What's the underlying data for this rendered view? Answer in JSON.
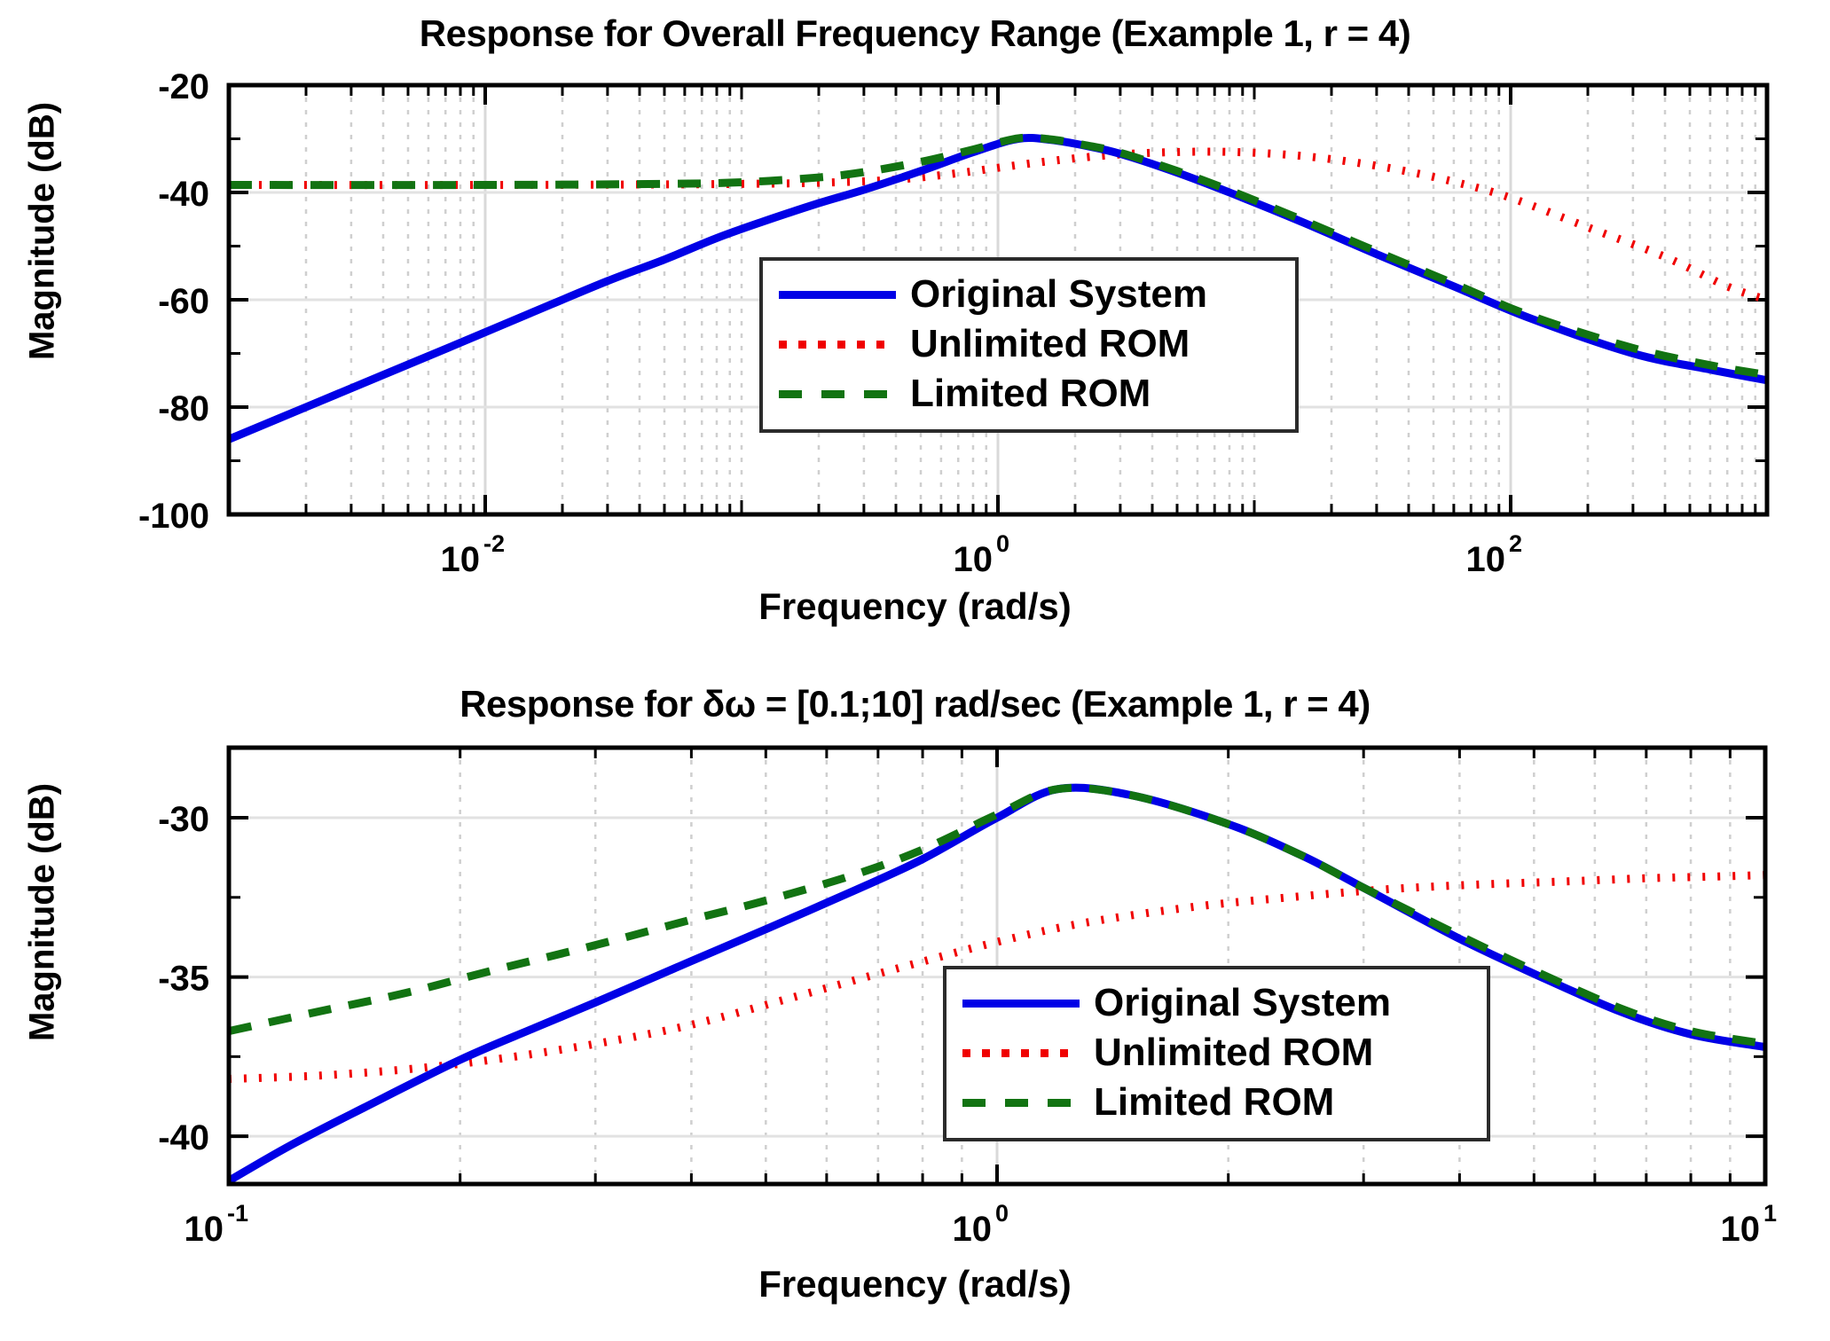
{
  "figure": {
    "background_color": "#ffffff",
    "colors": {
      "original_system": "#0000e6",
      "unlimited_rom": "#f00000",
      "limited_rom": "#127312",
      "axis": "#000000",
      "grid": "#d9d9d9"
    }
  },
  "panels": {
    "top": {
      "title": "Response for Overall Frequency Range (Example 1, r = 4)",
      "ylabel": "Magnitude (dB)",
      "xlabel": "Frequency  (rad/s)",
      "ytick_labels": [
        "-20",
        "-40",
        "-60",
        "-80",
        "-100"
      ],
      "xtick_labels": [
        "10",
        "10",
        "10"
      ],
      "xtick_exponents": [
        "-2",
        "0",
        "2"
      ],
      "legend": {
        "items": [
          {
            "label": "Original System",
            "style": "solid",
            "color": "#0000e6"
          },
          {
            "label": "Unlimited ROM",
            "style": "dotted",
            "color": "#f00000"
          },
          {
            "label": "Limited ROM",
            "style": "dashed",
            "color": "#127312"
          }
        ]
      }
    },
    "bottom": {
      "title": "Response for δω = [0.1;10] rad/sec (Example 1, r = 4)",
      "ylabel": "Magnitude (dB)",
      "xlabel": "Frequency  (rad/s)",
      "ytick_labels": [
        "-30",
        "-35",
        "-40"
      ],
      "xtick_labels": [
        "10",
        "10",
        "10"
      ],
      "xtick_exponents": [
        "-1",
        "0",
        "1"
      ],
      "legend": {
        "items": [
          {
            "label": "Original System",
            "style": "solid",
            "color": "#0000e6"
          },
          {
            "label": "Unlimited ROM",
            "style": "dotted",
            "color": "#f00000"
          },
          {
            "label": "Limited ROM",
            "style": "dashed",
            "color": "#127312"
          }
        ]
      }
    }
  },
  "chart_data": [
    {
      "type": "line",
      "id": "overall-frequency-range",
      "title": "Response for Overall Frequency Range (Example 1, r = 4)",
      "xlabel": "Frequency  (rad/s)",
      "ylabel": "Magnitude (dB)",
      "xscale": "log",
      "xlim": [
        0.001,
        1000
      ],
      "ylim": [
        -100,
        -20
      ],
      "yticks": [
        -20,
        -40,
        -60,
        -80,
        -100
      ],
      "xticks": [
        0.01,
        1,
        100
      ],
      "grid": true,
      "legend_position": "center",
      "series": [
        {
          "name": "Original System",
          "color": "#0000e6",
          "style": "solid",
          "x": [
            0.001,
            0.002,
            0.004,
            0.008,
            0.015,
            0.03,
            0.05,
            0.08,
            0.12,
            0.2,
            0.3,
            0.5,
            0.8,
            1.2,
            1.6,
            2.2,
            3.0,
            5.0,
            8.0,
            15.0,
            30.0,
            60.0,
            120.0,
            300.0,
            600.0,
            1000.0
          ],
          "y": [
            -86.0,
            -80.0,
            -74.0,
            -68.0,
            -62.5,
            -56.5,
            -52.5,
            -48.5,
            -45.5,
            -42.0,
            -39.5,
            -36.0,
            -32.5,
            -30.0,
            -30.2,
            -31.3,
            -32.8,
            -36.3,
            -40.0,
            -45.3,
            -51.5,
            -57.5,
            -63.5,
            -70.0,
            -73.0,
            -75.0
          ]
        },
        {
          "name": "Unlimited ROM",
          "color": "#f00000",
          "style": "dotted",
          "x": [
            0.001,
            0.01,
            0.05,
            0.1,
            0.2,
            0.4,
            0.7,
            1.0,
            1.5,
            2.5,
            4.0,
            7.0,
            12.0,
            20.0,
            35.0,
            60.0,
            100.0,
            200.0,
            400.0,
            700.0,
            1000.0
          ],
          "y": [
            -38.6,
            -38.6,
            -38.5,
            -38.4,
            -38.2,
            -37.6,
            -36.4,
            -35.4,
            -34.3,
            -33.2,
            -32.6,
            -32.4,
            -32.8,
            -33.8,
            -35.6,
            -38.0,
            -41.0,
            -46.5,
            -52.0,
            -57.5,
            -60.0
          ]
        },
        {
          "name": "Limited ROM",
          "color": "#127312",
          "style": "dashed",
          "x": [
            0.001,
            0.01,
            0.05,
            0.1,
            0.2,
            0.3,
            0.5,
            0.8,
            1.2,
            1.6,
            2.2,
            3.0,
            5.0,
            8.0,
            15.0,
            30.0,
            60.0,
            120.0,
            300.0,
            600.0,
            1000.0
          ],
          "y": [
            -38.6,
            -38.6,
            -38.4,
            -38.1,
            -37.2,
            -36.2,
            -34.3,
            -32.0,
            -29.9,
            -30.1,
            -31.2,
            -32.6,
            -36.0,
            -39.6,
            -44.9,
            -51.0,
            -57.0,
            -63.0,
            -69.0,
            -72.2,
            -74.0
          ]
        }
      ]
    },
    {
      "type": "line",
      "id": "band-limited-0p1-to-10",
      "title": "Response for δω = [0.1;10] rad/sec (Example 1, r = 4)",
      "xlabel": "Frequency  (rad/s)",
      "ylabel": "Magnitude (dB)",
      "xscale": "log",
      "xlim": [
        0.1,
        10
      ],
      "ylim": [
        -41.5,
        -27.8
      ],
      "yticks": [
        -30,
        -35,
        -40
      ],
      "xticks": [
        0.1,
        1,
        10
      ],
      "grid": true,
      "legend_position": "lower right",
      "series": [
        {
          "name": "Original System",
          "color": "#0000e6",
          "style": "solid",
          "x": [
            0.1,
            0.12,
            0.15,
            0.2,
            0.25,
            0.3,
            0.4,
            0.5,
            0.65,
            0.8,
            1.0,
            1.2,
            1.5,
            2.0,
            2.5,
            3.0,
            4.0,
            5.0,
            6.5,
            8.0,
            10.0
          ],
          "y": [
            -41.4,
            -40.3,
            -39.1,
            -37.6,
            -36.6,
            -35.8,
            -34.5,
            -33.5,
            -32.3,
            -31.3,
            -30.0,
            -29.1,
            -29.3,
            -30.2,
            -31.2,
            -32.2,
            -33.8,
            -34.9,
            -36.1,
            -36.8,
            -37.2
          ]
        },
        {
          "name": "Unlimited ROM",
          "color": "#f00000",
          "style": "dotted",
          "x": [
            0.1,
            0.13,
            0.17,
            0.22,
            0.3,
            0.4,
            0.55,
            0.75,
            1.0,
            1.3,
            1.8,
            2.4,
            3.2,
            4.2,
            5.5,
            7.0,
            8.5,
            10.0
          ],
          "y": [
            -38.2,
            -38.1,
            -37.9,
            -37.6,
            -37.1,
            -36.5,
            -35.6,
            -34.7,
            -33.9,
            -33.3,
            -32.8,
            -32.5,
            -32.25,
            -32.1,
            -32.0,
            -31.9,
            -31.85,
            -31.8
          ]
        },
        {
          "name": "Limited ROM",
          "color": "#127312",
          "style": "dashed",
          "x": [
            0.1,
            0.13,
            0.17,
            0.22,
            0.3,
            0.4,
            0.5,
            0.65,
            0.8,
            1.0,
            1.2,
            1.5,
            2.0,
            2.5,
            3.0,
            4.0,
            5.0,
            6.5,
            8.0,
            10.0
          ],
          "y": [
            -36.7,
            -36.1,
            -35.5,
            -34.8,
            -34.0,
            -33.2,
            -32.6,
            -31.8,
            -31.0,
            -29.9,
            -29.1,
            -29.3,
            -30.2,
            -31.2,
            -32.2,
            -33.7,
            -34.8,
            -36.0,
            -36.7,
            -37.1
          ]
        }
      ]
    }
  ]
}
